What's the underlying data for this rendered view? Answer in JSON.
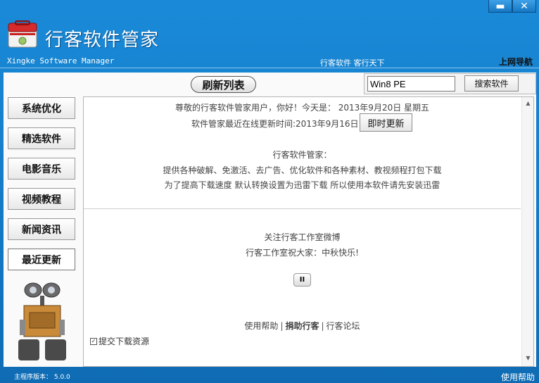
{
  "window": {
    "minimize_glyph": "▬",
    "close_glyph": "✕"
  },
  "header": {
    "title": "行客软件管家",
    "subtitle": "Xingke Software Manager",
    "slogan": "行客软件 客行天下",
    "nav_link": "上网导航"
  },
  "toolbar": {
    "refresh_label": "刷新列表",
    "search_value": "Win8 PE",
    "search_button": "搜索软件"
  },
  "sidebar": {
    "items": [
      {
        "label": "系统优化"
      },
      {
        "label": "精选软件"
      },
      {
        "label": "电影音乐"
      },
      {
        "label": "视频教程"
      },
      {
        "label": "新闻资讯"
      },
      {
        "label": "最近更新"
      }
    ],
    "active_index": 5
  },
  "content": {
    "greeting": "尊敬的行客软件管家用户，你好！今天是： 2013年9月20日 星期五",
    "last_update": "软件管家最近在线更新时间:2013年9月16日",
    "update_button": "即时更新",
    "about_title": "行客软件管家：",
    "about_line1": "提供各种破解、免激活、去广告、优化软件和各种素材、教视频程打包下载",
    "about_line2": "为了提高下载速度 默认转换设置为迅雷下载 所以使用本软件请先安装迅雷",
    "follow_text": "关注行客工作室微博",
    "wish_text": "行客工作室祝大家：中秋快乐!",
    "pause_glyph": "II",
    "links": {
      "help": "使用帮助",
      "donate": "捐助行客",
      "forum": "行客论坛",
      "separator": "|"
    },
    "submit_label": "提交下载资源"
  },
  "status": {
    "version": "主程序版本： 5.0.0",
    "help": "使用帮助"
  },
  "colors": {
    "title_bar": "#1a8ad8",
    "panel_bg": "#ffffff"
  }
}
